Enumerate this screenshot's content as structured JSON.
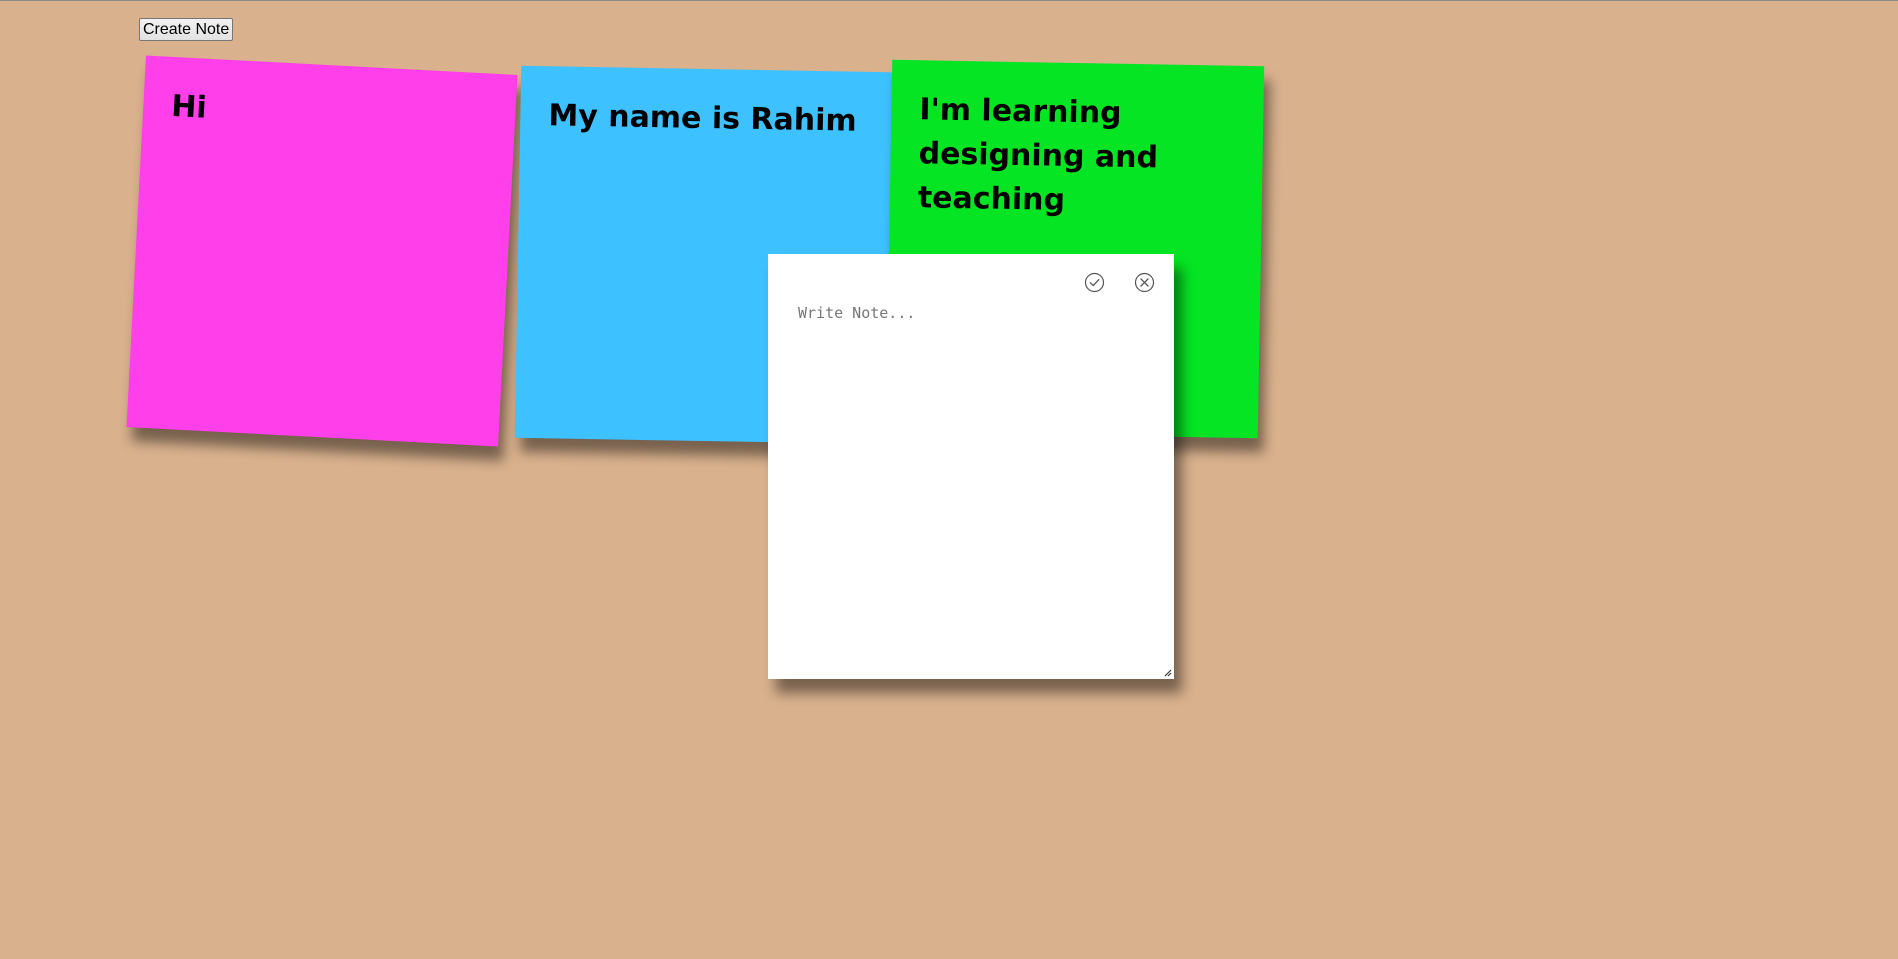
{
  "toolbar": {
    "create_label": "Create Note"
  },
  "notes": [
    {
      "text": "Hi",
      "color": "#ff3fe9"
    },
    {
      "text": "My name is Rahim",
      "color": "#3ec1ff"
    },
    {
      "text": "I'm learning designing and teaching",
      "color": "#05e524"
    }
  ],
  "editor": {
    "placeholder": "Write Note...",
    "value": "",
    "confirm_icon": "check-circle-icon",
    "cancel_icon": "close-circle-icon"
  },
  "colors": {
    "background": "#d9b18d",
    "editor_background": "#ffffff"
  }
}
